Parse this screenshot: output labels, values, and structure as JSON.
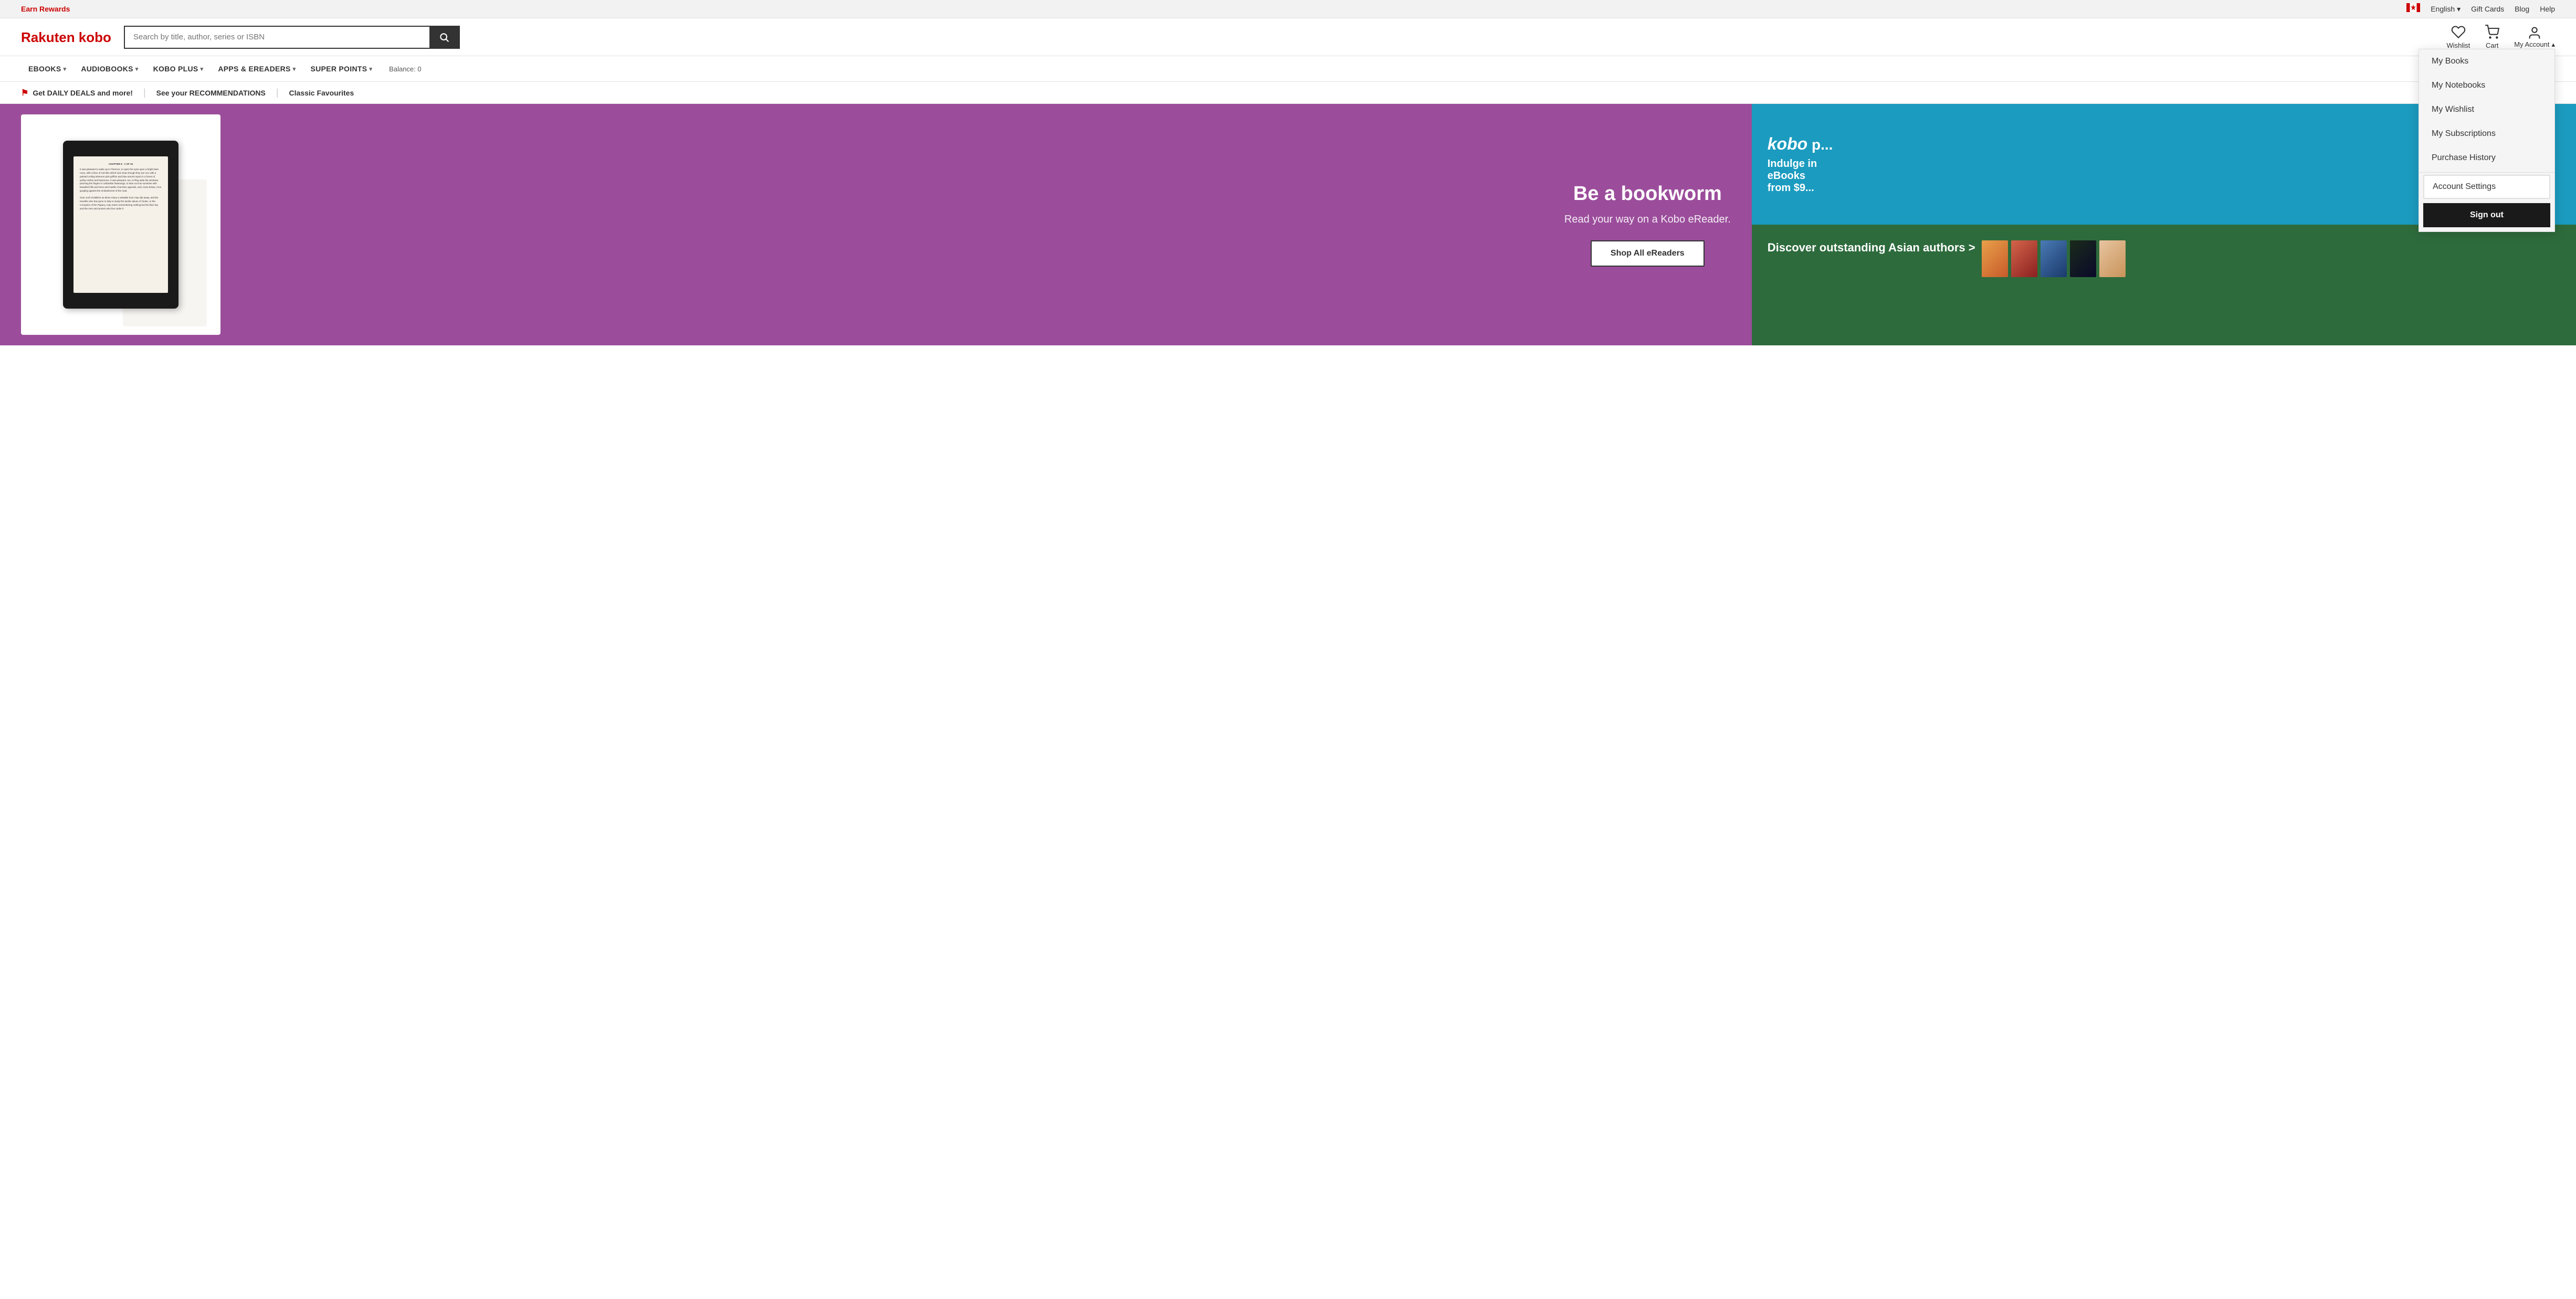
{
  "topbar": {
    "earn_rewards": "Earn Rewards",
    "language": "English",
    "gift_cards": "Gift Cards",
    "blog": "Blog",
    "help": "Help"
  },
  "header": {
    "logo": "Rakuten kobo",
    "search_placeholder": "Search by title, author, series or ISBN",
    "wishlist_label": "Wishlist",
    "cart_label": "Cart",
    "my_account_label": "My Account"
  },
  "nav": {
    "items": [
      {
        "label": "eBOOKS",
        "has_dropdown": true
      },
      {
        "label": "AUDIOBOOKS",
        "has_dropdown": true
      },
      {
        "label": "KOBO PLUS",
        "has_dropdown": true
      },
      {
        "label": "APPS & eREADERS",
        "has_dropdown": true
      },
      {
        "label": "SUPER POINTS",
        "has_dropdown": true
      }
    ],
    "balance_label": "Balance: 0"
  },
  "promo": {
    "daily_deals": "Get DAILY DEALS and more!",
    "recommendations": "See your RECOMMENDATIONS",
    "classics": "Classic Favourites"
  },
  "hero": {
    "title": "Be a bookworm",
    "subtitle": "Read your way on a Kobo eReader.",
    "cta": "Shop All eReaders",
    "ereader_text": "CHAPTER 9 · 1 OF 19\n\nIt was pleasant to wake up in Florence, to open the eyes upon a bright bare room, with a floor of red tiles which look clean though they are not; with a painted ceiling whereon pink griffins and blue amorini sport in a forest of yellow violins and bassoons. It was pleasant, too, to fling wide the windows, pinching the fingers in unfamiliar fastenings, to lean out into sunshine with beautiful hills and trees and marble churches opposite, and, close below, Arnos gurgling against the embankment of the road.\n\nOver such trivialities as these many a valuable hour may slip away, and the traveller who has gone to Italy to study the tactile values of Giotto, or the corruption of the Papacy, may return remembering nothing but the blue sky and the men and women who live under it."
  },
  "panel_top": {
    "brand": "kobo p",
    "line1": "Indulge",
    "line2": "eBooks",
    "line3": "from $9"
  },
  "panel_bottom": {
    "title": "Discover outstanding Asian authors >"
  },
  "account_dropdown": {
    "my_books": "My Books",
    "my_notebooks": "My Notebooks",
    "my_wishlist": "My Wishlist",
    "my_subscriptions": "My Subscriptions",
    "purchase_history": "Purchase History",
    "account_settings": "Account Settings",
    "sign_out": "Sign out"
  },
  "colors": {
    "brand_red": "#c00",
    "hero_purple": "#9b4d9b",
    "panel_teal": "#1b9bbf",
    "panel_green": "#2d6b3c",
    "nav_dark": "#1a1a1a"
  }
}
